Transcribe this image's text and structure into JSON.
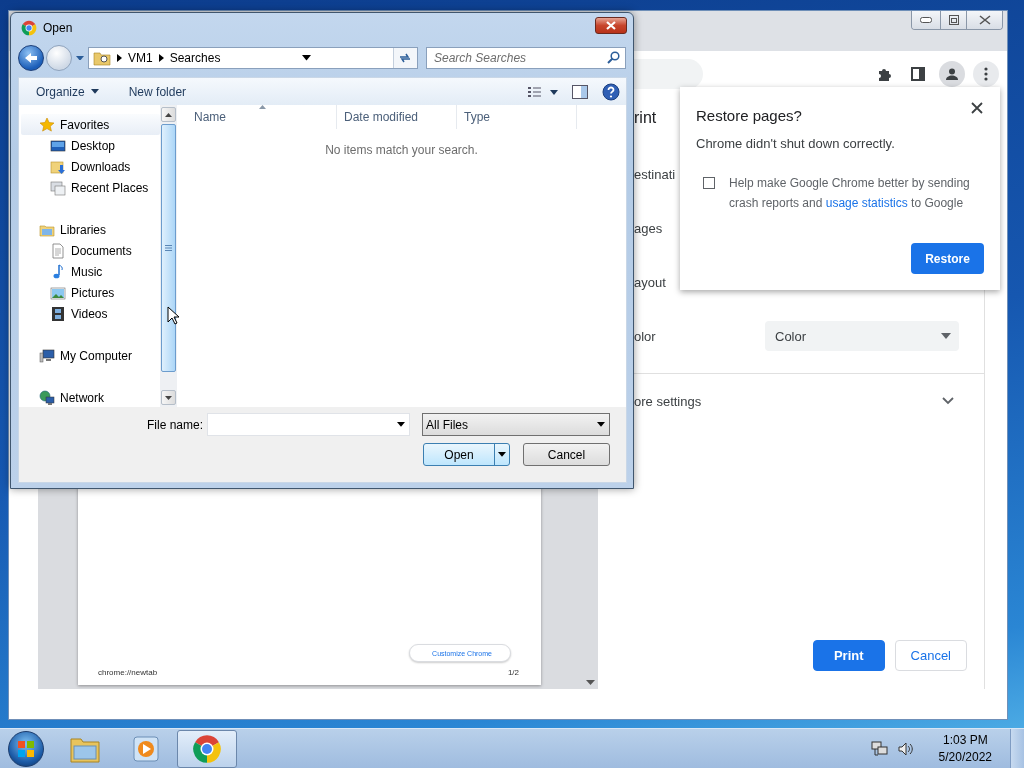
{
  "chrome_window": {
    "print_preview": {
      "customize_button": "Customize Chrome",
      "footer_left": "chrome://newtab",
      "footer_right": "1/2"
    },
    "print_settings": {
      "title": "rint",
      "rows": [
        {
          "label": "estinati"
        },
        {
          "label": "ages"
        },
        {
          "label": "ayout"
        },
        {
          "label": "olor",
          "value": "Color"
        }
      ],
      "more_settings": "ore settings",
      "buttons": [
        {
          "label": "Print",
          "kind": "primary"
        },
        {
          "label": "Cancel",
          "kind": "secondary"
        }
      ]
    }
  },
  "restore_popup": {
    "title": "Restore pages?",
    "message": "Chrome didn't shut down correctly.",
    "checkbox": {
      "checked": false,
      "text": "Help make Google Chrome better by sending crash reports and ",
      "link": "usage statistics",
      "text_after": " to Google"
    },
    "button": "Restore"
  },
  "open_dialog": {
    "title": "Open",
    "breadcrumb": [
      "VM1",
      "Searches"
    ],
    "search": {
      "placeholder": "Search Searches"
    },
    "commands": [
      {
        "label": "Organize",
        "menu": true
      },
      {
        "label": "New folder",
        "menu": false
      }
    ],
    "nav_pane": [
      {
        "label": "Favorites",
        "kind": "star",
        "selected": true,
        "children": [
          {
            "label": "Desktop",
            "kind": "desktop",
            "selected": false
          },
          {
            "label": "Downloads",
            "kind": "downloads",
            "selected": false
          },
          {
            "label": "Recent Places",
            "kind": "recent",
            "selected": false
          }
        ]
      },
      {
        "label": "Libraries",
        "kind": "library",
        "selected": false,
        "children": [
          {
            "label": "Documents",
            "kind": "documents",
            "selected": false
          },
          {
            "label": "Music",
            "kind": "music",
            "selected": false
          },
          {
            "label": "Pictures",
            "kind": "pictures",
            "selected": false
          },
          {
            "label": "Videos",
            "kind": "videos",
            "selected": false
          }
        ]
      },
      {
        "label": "My Computer",
        "kind": "computer",
        "selected": false
      },
      {
        "label": "Network",
        "kind": "network",
        "selected": false
      }
    ],
    "columns": [
      "Name",
      "Date modified",
      "Type"
    ],
    "empty_message": "No items match your search.",
    "file_name_label": "File name:",
    "file_type": "All Files",
    "buttons": [
      {
        "label": "Open",
        "kind": "split"
      },
      {
        "label": "Cancel",
        "kind": "plain"
      }
    ]
  },
  "taskbar": {
    "apps": [
      {
        "kind": "explorer",
        "selected": false
      },
      {
        "kind": "media",
        "selected": false
      },
      {
        "kind": "chrome",
        "selected": true
      }
    ],
    "clock": {
      "time": "1:03 PM",
      "date": "5/20/2022"
    }
  }
}
